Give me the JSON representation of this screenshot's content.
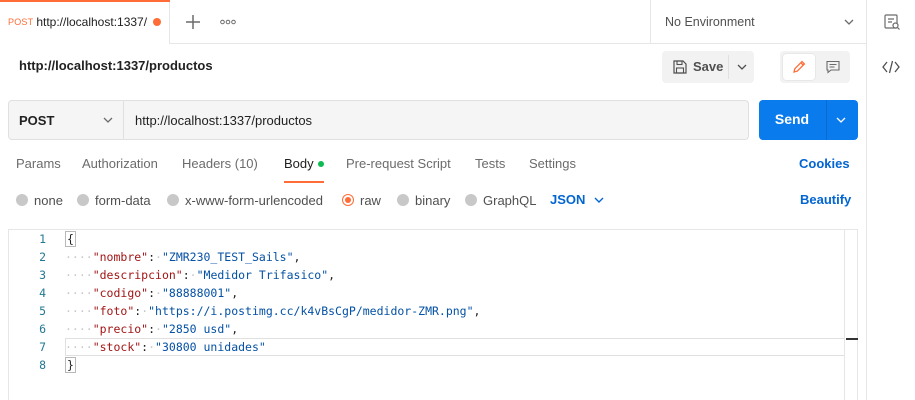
{
  "tab": {
    "method": "POST",
    "title": "http://localhost:1337/",
    "unsaved_color": "#ff6c37"
  },
  "icons": {
    "new_tab": "plus-icon",
    "more": "more-horizontal-icon",
    "environment": "environment-quicklook-icon",
    "code": "code-icon",
    "save": "floppy-disk-icon",
    "edit": "pencil-icon",
    "comment": "comment-icon"
  },
  "environment": {
    "selected": "No Environment"
  },
  "request": {
    "name": "http://localhost:1337/productos",
    "save_label": "Save",
    "method": "POST",
    "url": "http://localhost:1337/productos",
    "send_label": "Send"
  },
  "request_tabs": [
    {
      "label": "Params"
    },
    {
      "label": "Authorization"
    },
    {
      "label": "Headers (10)"
    },
    {
      "label": "Body"
    },
    {
      "label": "Pre-request Script"
    },
    {
      "label": "Tests"
    },
    {
      "label": "Settings"
    }
  ],
  "active_tab": "Body",
  "cookies_label": "Cookies",
  "body_modes": [
    {
      "label": "none"
    },
    {
      "label": "form-data"
    },
    {
      "label": "x-www-form-urlencoded"
    },
    {
      "label": "raw"
    },
    {
      "label": "binary"
    },
    {
      "label": "GraphQL"
    }
  ],
  "selected_body_mode": "raw",
  "language": "JSON",
  "beautify_label": "Beautify",
  "editor": {
    "line_numbers": [
      "1",
      "2",
      "3",
      "4",
      "5",
      "6",
      "7",
      "8"
    ],
    "open_brace": "{",
    "close_brace": "}",
    "fields": [
      {
        "key": "\"nombre\"",
        "value": "\"ZMR230_TEST_Sails\"",
        "comma": ","
      },
      {
        "key": "\"descripcion\"",
        "value": "\"Medidor Trifasico\"",
        "comma": ","
      },
      {
        "key": "\"codigo\"",
        "value": "\"88888001\"",
        "comma": ","
      },
      {
        "key": "\"foto\"",
        "value": "\"https://i.postimg.cc/k4vBsCgP/medidor-ZMR.png\"",
        "comma": ","
      },
      {
        "key": "\"precio\"",
        "value": "\"2850 usd\"",
        "comma": ","
      },
      {
        "key": "\"stock\"",
        "value": "\"30800 unidades\"",
        "comma": ""
      }
    ]
  },
  "colors": {
    "accent": "#ff6c37",
    "send_button": "#097bed",
    "link": "#0265d2",
    "json_key": "#a31515",
    "json_string": "#0451a5",
    "line_number": "#237893",
    "body_indicator": "#0cbb52"
  }
}
